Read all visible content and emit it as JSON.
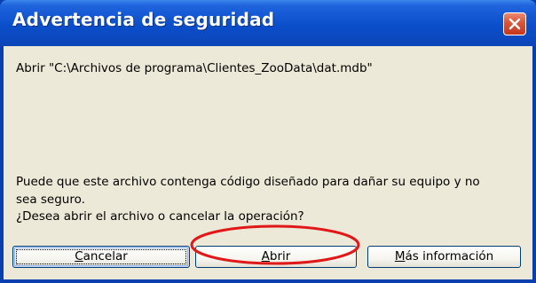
{
  "dialog": {
    "title": "Advertencia de seguridad",
    "close_icon": "close-icon",
    "path_message": "Abrir \"C:\\Archivos de programa\\Clientes_ZooData\\dat.mdb\"",
    "warning_line1": "Puede que este archivo contenga código diseñado para dañar su equipo y no",
    "warning_line2": "sea seguro.",
    "warning_line3": "¿Desea abrir el archivo o cancelar la operación?"
  },
  "buttons": {
    "cancel": {
      "mnemonic": "C",
      "rest": "ancelar"
    },
    "open": {
      "mnemonic": "A",
      "rest": "brir"
    },
    "more_info": {
      "mnemonic": "M",
      "rest": "ás información"
    }
  },
  "colors": {
    "title_bar": "#0b4ecb",
    "client_background": "#ece9d8",
    "annotation_ellipse": "#e01818"
  }
}
